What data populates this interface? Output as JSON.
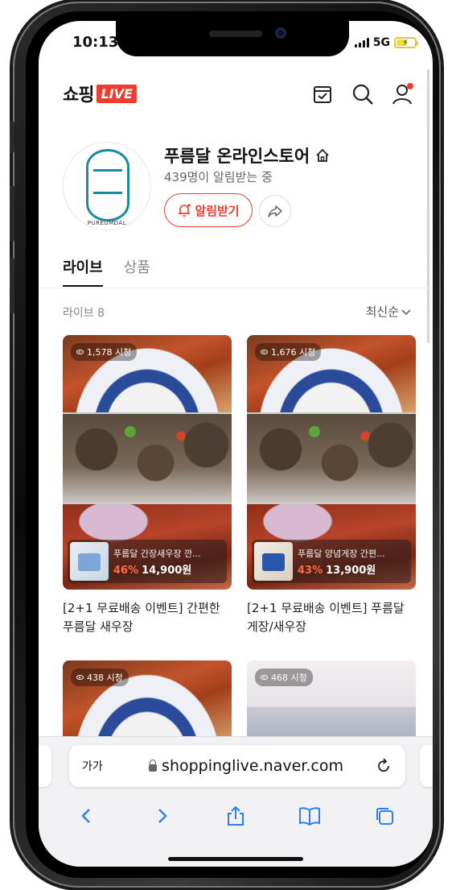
{
  "status_bar": {
    "time": "10:13",
    "network": "5G",
    "battery_level": 0.6
  },
  "header": {
    "brand": "쇼핑",
    "badge": "LIVE",
    "icons": [
      "calendar-check-icon",
      "search-icon",
      "user-icon"
    ],
    "accent_color": "#f03c2e"
  },
  "store": {
    "name": "푸름달 온라인스토어",
    "subscribers": "439명이 알림받는 중",
    "logo_caption": "PUREUMDAL",
    "notify_label": "알림받기"
  },
  "tabs": [
    {
      "label": "라이브",
      "active": true
    },
    {
      "label": "상품",
      "active": false
    }
  ],
  "list": {
    "count_label": "라이브 8",
    "sort_label": "최신순"
  },
  "cards": [
    {
      "views": "1,578 시청",
      "product_name": "푸름달 간장새우장 깐...",
      "discount": "46%",
      "price": "14,900원",
      "title": "[2+1 무료배송 이벤트] 간편한 푸름달 새우장"
    },
    {
      "views": "1,676 시청",
      "product_name": "푸름달 양념게장 간편...",
      "discount": "43%",
      "price": "13,900원",
      "title": "[2+1 무료배송 이벤트] 푸름달 게장/새우장"
    },
    {
      "views": "438 시청"
    },
    {
      "views": "468 시청"
    }
  ],
  "browser": {
    "text_size_label": "가가",
    "url": "shoppinglive.naver.com"
  }
}
